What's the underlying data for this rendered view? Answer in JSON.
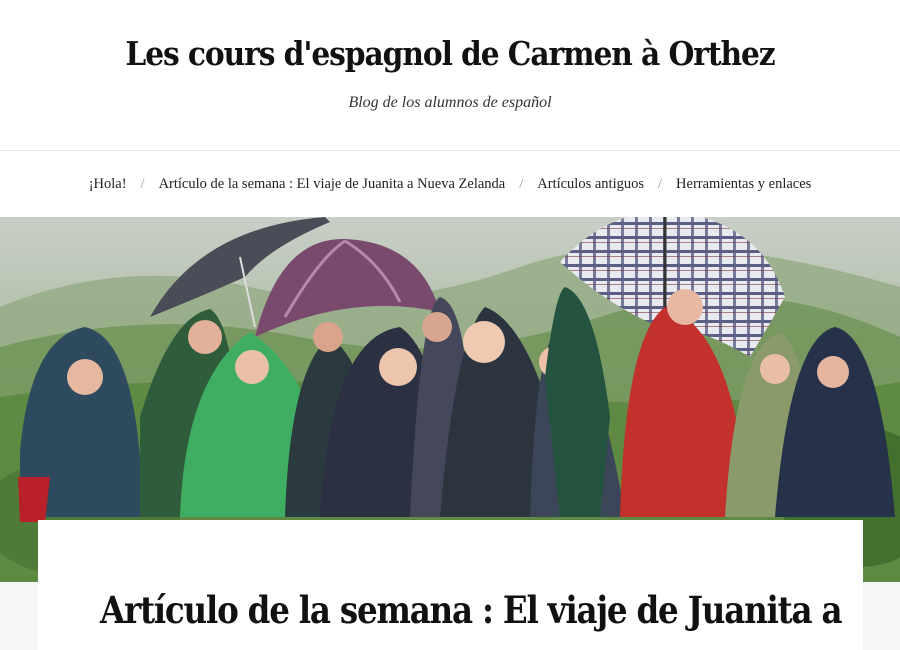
{
  "site": {
    "title": "Les cours d'espagnol de Carmen à Orthez",
    "description": "Blog de los alumnos de español"
  },
  "nav": {
    "items": [
      {
        "label": "¡Hola!"
      },
      {
        "label": "Artículo de la semana : El viaje de Juanita a Nueva Zelanda"
      },
      {
        "label": "Artículos antiguos"
      },
      {
        "label": "Herramientas y enlaces"
      }
    ],
    "separator": "/"
  },
  "hero": {
    "subject": "group photo of people in rain ponchos with umbrellas"
  },
  "post": {
    "title": "Artículo de la semana : El viaje de Juanita a"
  },
  "colors": {
    "background": "#ffffff",
    "text": "#222222",
    "rule": "#e2e2e2",
    "page_below": "#f6f6f6"
  }
}
